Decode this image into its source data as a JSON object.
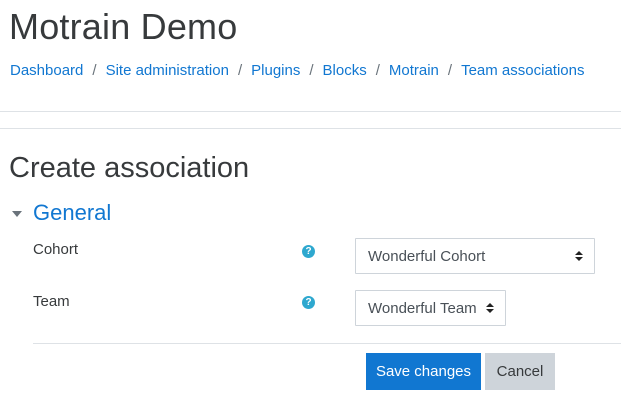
{
  "header": {
    "site_title": "Motrain Demo"
  },
  "breadcrumb": {
    "items": [
      "Dashboard",
      "Site administration",
      "Plugins",
      "Blocks",
      "Motrain",
      "Team associations"
    ],
    "separator": "/"
  },
  "page": {
    "heading": "Create association"
  },
  "section": {
    "title": "General"
  },
  "form": {
    "cohort": {
      "label": "Cohort",
      "help_symbol": "?",
      "selected": "Wonderful Cohort"
    },
    "team": {
      "label": "Team",
      "help_symbol": "?",
      "selected": "Wonderful Team"
    }
  },
  "buttons": {
    "save": "Save changes",
    "cancel": "Cancel"
  },
  "colors": {
    "link": "#1177d1",
    "primary": "#1177d1",
    "help_icon": "#2ea8cf",
    "secondary_button": "#ced4da"
  },
  "icons": {
    "section_toggle": "caret-down-icon",
    "help": "question-circle-icon",
    "select_arrows": "sort-arrows-icon"
  }
}
